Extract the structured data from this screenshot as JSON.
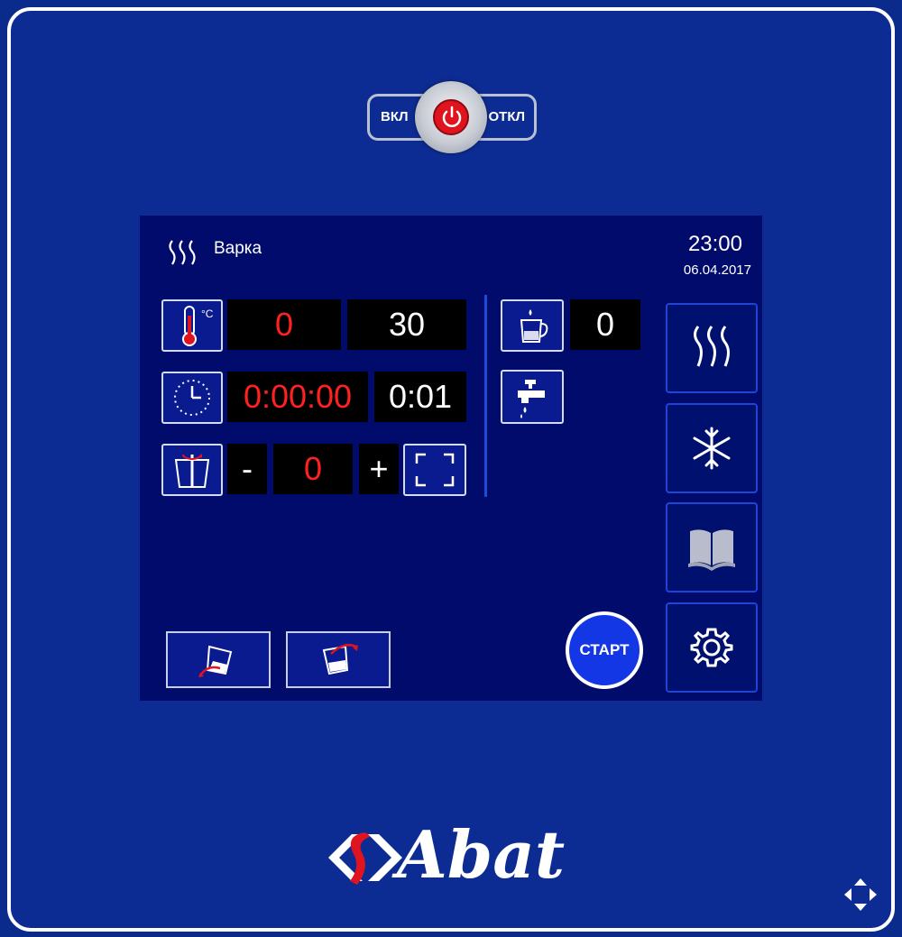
{
  "power_switch": {
    "on_label": "ВКЛ",
    "off_label": "ОТКЛ"
  },
  "header": {
    "mode_icon": "steam-icon",
    "mode_label": "Варка",
    "time": "23:00",
    "date": "06.04.2017"
  },
  "params": {
    "temperature": {
      "icon": "thermometer-celsius-icon",
      "current": "0",
      "setpoint": "30"
    },
    "time": {
      "icon": "clock-icon",
      "elapsed": "0:00:00",
      "setpoint": "0:01"
    },
    "tilt": {
      "icon": "kettle-tilt-icon",
      "minus_label": "-",
      "value": "0",
      "plus_label": "+",
      "expand_icon": "fullscreen-icon"
    },
    "water": {
      "icon": "cup-icon",
      "value": "0",
      "tap_icon": "water-tap-icon"
    }
  },
  "side_menu": [
    {
      "name": "steam-mode",
      "icon": "steam-icon"
    },
    {
      "name": "cooling-mode",
      "icon": "snowflake-icon"
    },
    {
      "name": "recipe-book",
      "icon": "book-icon"
    },
    {
      "name": "settings",
      "icon": "gear-icon"
    }
  ],
  "bottom": {
    "tilt_down_icon": "tilt-down-icon",
    "tilt_up_icon": "tilt-up-icon",
    "start_label": "СТАРТ"
  },
  "brand": {
    "logo_text": "Abat"
  },
  "colors": {
    "panel": "#0d2c93",
    "screen": "#000b6b",
    "active_value": "#ff2020",
    "start_button": "#1437e6"
  }
}
